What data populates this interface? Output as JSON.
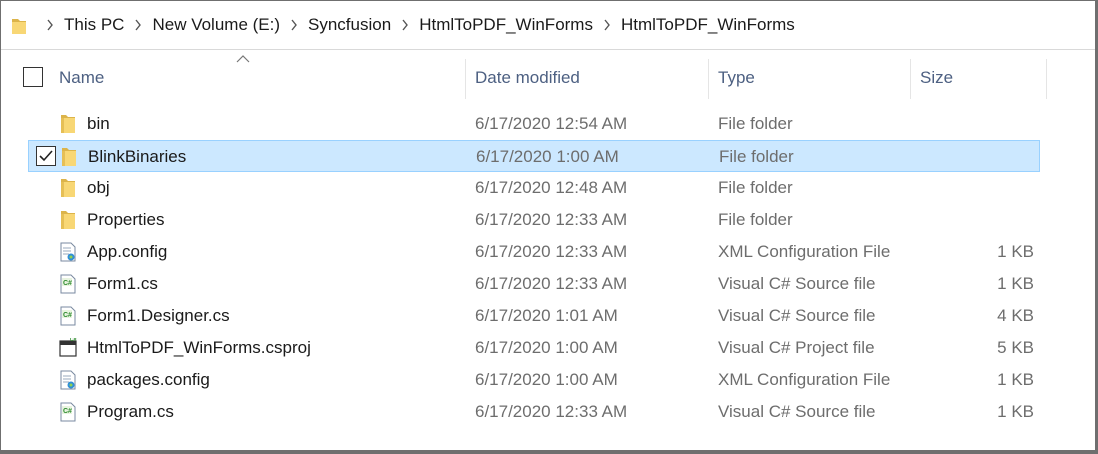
{
  "breadcrumbs": [
    "This PC",
    "New Volume (E:)",
    "Syncfusion",
    "HtmlToPDF_WinForms",
    "HtmlToPDF_WinForms"
  ],
  "columns": {
    "name": "Name",
    "date": "Date modified",
    "type": "Type",
    "size": "Size"
  },
  "files": [
    {
      "name": "bin",
      "date": "6/17/2020 12:54 AM",
      "type": "File folder",
      "size": "",
      "icon": "folder-icon",
      "selected": false
    },
    {
      "name": "BlinkBinaries",
      "date": "6/17/2020 1:00 AM",
      "type": "File folder",
      "size": "",
      "icon": "folder-icon",
      "selected": true
    },
    {
      "name": "obj",
      "date": "6/17/2020 12:48 AM",
      "type": "File folder",
      "size": "",
      "icon": "folder-icon",
      "selected": false
    },
    {
      "name": "Properties",
      "date": "6/17/2020 12:33 AM",
      "type": "File folder",
      "size": "",
      "icon": "folder-icon",
      "selected": false
    },
    {
      "name": "App.config",
      "date": "6/17/2020 12:33 AM",
      "type": "XML Configuration File",
      "size": "1 KB",
      "icon": "config-file-icon",
      "selected": false
    },
    {
      "name": "Form1.cs",
      "date": "6/17/2020 12:33 AM",
      "type": "Visual C# Source file",
      "size": "1 KB",
      "icon": "csharp-file-icon",
      "selected": false
    },
    {
      "name": "Form1.Designer.cs",
      "date": "6/17/2020 1:01 AM",
      "type": "Visual C# Source file",
      "size": "4 KB",
      "icon": "csharp-file-icon",
      "selected": false
    },
    {
      "name": "HtmlToPDF_WinForms.csproj",
      "date": "6/17/2020 1:00 AM",
      "type": "Visual C# Project file",
      "size": "5 KB",
      "icon": "csproj-file-icon",
      "selected": false
    },
    {
      "name": "packages.config",
      "date": "6/17/2020 1:00 AM",
      "type": "XML Configuration File",
      "size": "1 KB",
      "icon": "config-file-icon",
      "selected": false
    },
    {
      "name": "Program.cs",
      "date": "6/17/2020 12:33 AM",
      "type": "Visual C# Source file",
      "size": "1 KB",
      "icon": "csharp-file-icon",
      "selected": false
    }
  ],
  "colors": {
    "selection_bg": "#cce8ff",
    "selection_border": "#99d1ff",
    "header_text": "#4d6082",
    "folder_yellow": "#f8d775"
  }
}
